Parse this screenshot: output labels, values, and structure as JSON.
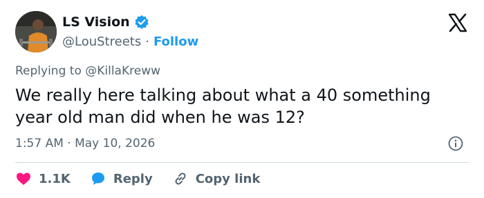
{
  "author": {
    "display_name": "LS Vision",
    "handle": "@LouStreets",
    "separator": "·",
    "follow_label": "Follow"
  },
  "reply_context": "Replying to @KillaKreww",
  "tweet": {
    "text": "We really here talking about what a 40 something year old man did when he was 12?",
    "timestamp": "1:57 AM · May 10, 2026"
  },
  "actions": {
    "like_count": "1.1K",
    "reply_label": "Reply",
    "copy_link_label": "Copy link"
  },
  "colors": {
    "brand_blue": "#1d9bf0",
    "like_red": "#f91880",
    "muted_text": "#536471",
    "primary_text": "#0f1419"
  },
  "icons": {
    "logo": "x-logo-icon",
    "verified": "verified-badge-icon",
    "info": "info-icon",
    "like": "heart-icon",
    "reply": "speech-bubble-icon",
    "copy": "link-icon"
  }
}
